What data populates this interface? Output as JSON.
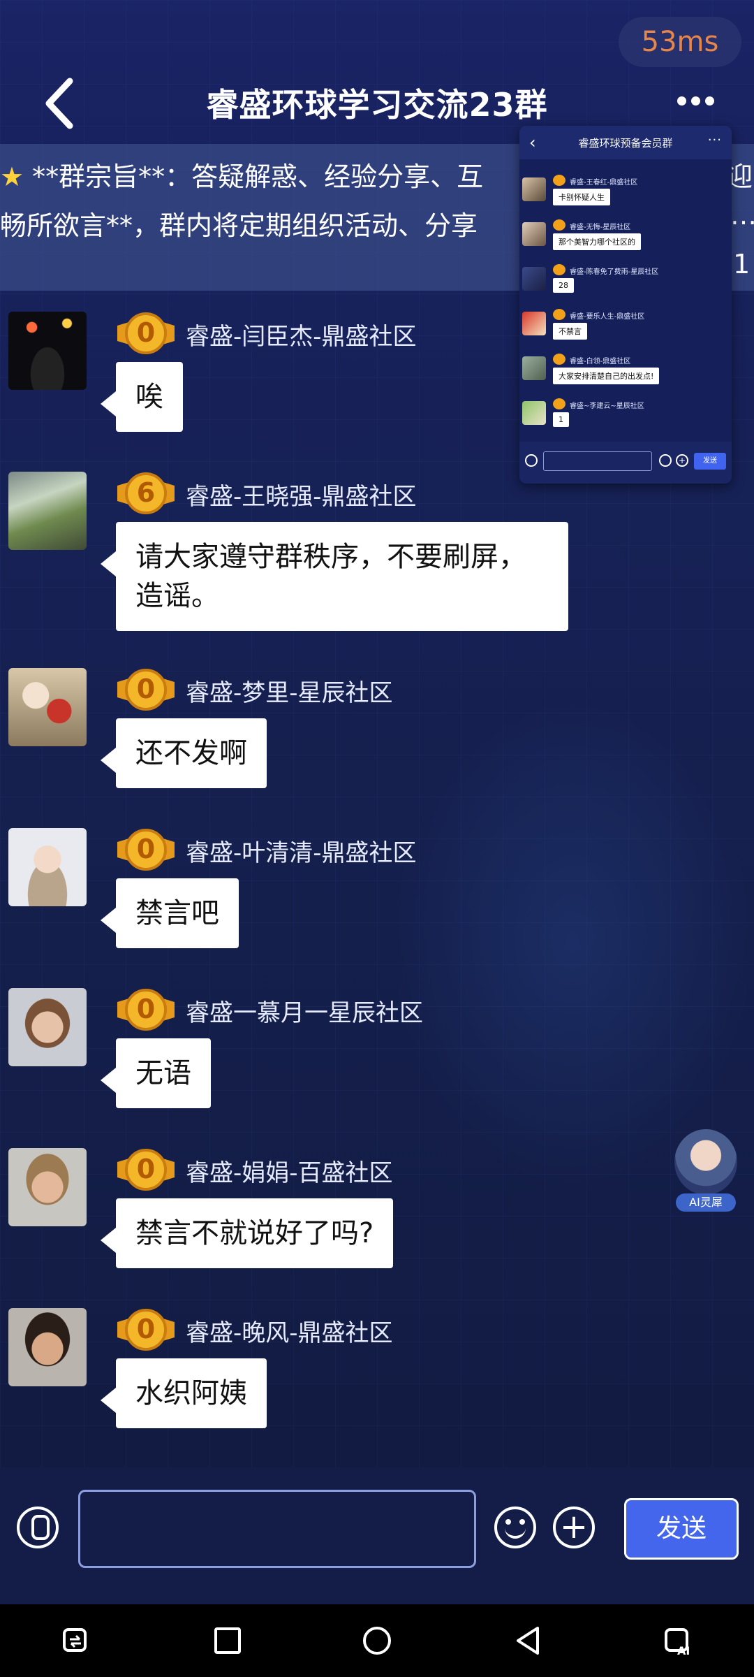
{
  "status": {
    "latency": "53ms"
  },
  "header": {
    "title": "睿盛环球学习交流23群"
  },
  "notice": {
    "line1": "**群宗旨**：答疑解惑、经验分享、互",
    "line2": "畅所欲言**，群内将定期组织活动、分享",
    "line1_tail": "迎",
    "line2_tail": "…",
    "line3_tail": "1"
  },
  "mini_window": {
    "title": "睿盛环球预备会员群",
    "send_label": "发送",
    "messages": [
      {
        "name": "睿盛-王春红-鼎盛社区",
        "text": "卡别怀疑人生"
      },
      {
        "name": "睿盛-无悔-星辰社区",
        "text": "那个美智力哪个社区的"
      },
      {
        "name": "睿盛-陈春免了费雨-星辰社区",
        "text": "28"
      },
      {
        "name": "睿盛-要乐人生-鼎盛社区",
        "text": "不禁言"
      },
      {
        "name": "睿盛-白领-鼎盛社区",
        "text": "大家安排清楚自己的出发点!"
      },
      {
        "name": "睿盛~李建云~星辰社区",
        "text": "1"
      }
    ]
  },
  "messages": [
    {
      "level": "0",
      "name": "睿盛-闫臣杰-鼎盛社区",
      "text": "唉"
    },
    {
      "level": "6",
      "name": "睿盛-王晓强-鼎盛社区",
      "text": "请大家遵守群秩序，不要刷屏，造谣。"
    },
    {
      "level": "0",
      "name": "睿盛-梦里-星辰社区",
      "text": "还不发啊"
    },
    {
      "level": "0",
      "name": "睿盛-叶清清-鼎盛社区",
      "text": "禁言吧"
    },
    {
      "level": "0",
      "name": "睿盛一慕月一星辰社区",
      "text": "无语"
    },
    {
      "level": "0",
      "name": "睿盛-娟娟-百盛社区",
      "text": "禁言不就说好了吗?"
    },
    {
      "level": "0",
      "name": "睿盛-晚风-鼎盛社区",
      "text": "水织阿姨"
    }
  ],
  "ai_assistant": {
    "label": "AI灵犀"
  },
  "input_bar": {
    "placeholder": "",
    "send_label": "发送"
  },
  "colors": {
    "send_button": "#4466ec",
    "latency_text": "#e8864a",
    "medal": "#f1a11a"
  },
  "icons": [
    "back-icon",
    "more-icon",
    "star-icon",
    "mic-icon",
    "emoji-icon",
    "plus-icon",
    "nav-recent-icon",
    "nav-square-icon",
    "nav-home-icon",
    "nav-back-icon",
    "nav-ai-icon"
  ]
}
